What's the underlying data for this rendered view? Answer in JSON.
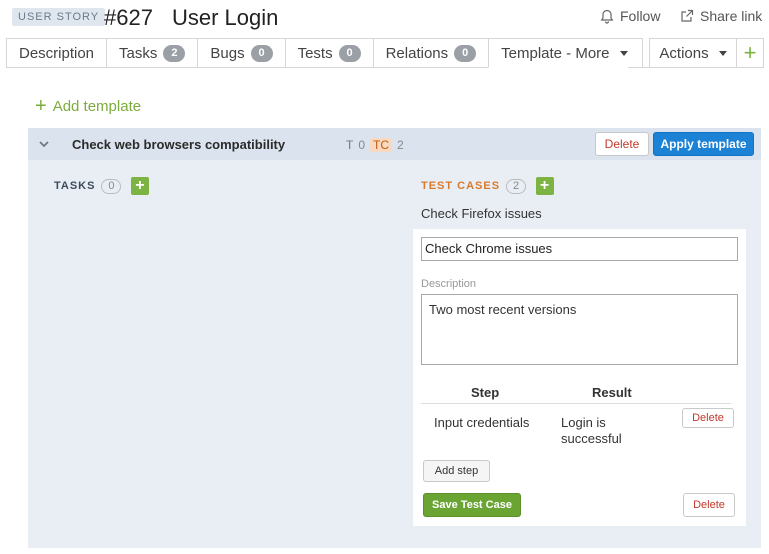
{
  "header": {
    "badge": "USER STORY",
    "entity_id": "#627",
    "title": "User Login",
    "follow_label": "Follow",
    "share_label": "Share link"
  },
  "tabs": [
    {
      "label": "Description",
      "count": null
    },
    {
      "label": "Tasks",
      "count": "2"
    },
    {
      "label": "Bugs",
      "count": "0"
    },
    {
      "label": "Tests",
      "count": "0"
    },
    {
      "label": "Relations",
      "count": "0"
    },
    {
      "label": "Template - More",
      "count": null
    }
  ],
  "actions_label": "Actions",
  "add_template_label": "Add template",
  "template": {
    "name": "Check web browsers compatibility",
    "t_label": "T",
    "t_count": "0",
    "tc_label": "TC",
    "tc_count": "2",
    "delete_label": "Delete",
    "apply_label": "Apply template"
  },
  "tasks_section": {
    "label": "TASKS",
    "count": "0"
  },
  "test_cases_section": {
    "label": "TEST CASES",
    "count": "2"
  },
  "test_case": {
    "existing_title": "Check Firefox issues",
    "name_value": "Check Chrome issues",
    "description_label": "Description",
    "description_value": "Two most recent versions",
    "steps_header": {
      "step": "Step",
      "result": "Result"
    },
    "step_row": {
      "step": "Input credentials",
      "result": "Login is successful",
      "delete_label": "Delete"
    },
    "add_step_label": "Add step",
    "save_label": "Save Test Case",
    "delete_label": "Delete"
  },
  "colors": {
    "accent_green": "#7cb342",
    "accent_blue": "#1b82d6",
    "test_cases_orange": "#d97a2b",
    "panel_bg": "#e9eef5"
  }
}
